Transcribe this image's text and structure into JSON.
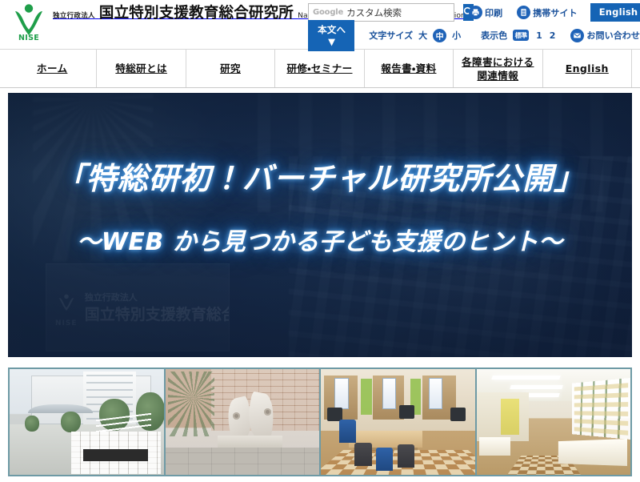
{
  "header": {
    "logo": {
      "mark_name": "nise-logo-mark",
      "acronym": "NISE",
      "sub_line": "独立行政法人",
      "main_line": "国立特別支援教育総合研究所",
      "english_line": "National Institute of Special Needs Education",
      "mark_color": "#1f9e4a"
    },
    "search": {
      "engine_label": "Google",
      "placeholder": "カスタム検索",
      "value": "",
      "button_icon": "search-icon",
      "button_color": "#1564b5"
    },
    "util_links": [
      {
        "icon": "printer-icon",
        "label": "印刷"
      },
      {
        "icon": "mobile-site-icon",
        "label": "携帯サイト"
      }
    ],
    "english_button": "English",
    "skip_button": "本文へ▼",
    "text_size": {
      "label": "文字サイズ",
      "options": [
        "大",
        "中",
        "小"
      ],
      "selected": "中"
    },
    "display_color": {
      "label": "表示色",
      "options": [
        "標準",
        "1",
        "2"
      ],
      "selected": "標準"
    },
    "contact": {
      "icon": "mail-icon",
      "label": "お問い合わせ"
    },
    "accent_color": "#1564b5",
    "link_color": "#19519b"
  },
  "nav": {
    "items": [
      {
        "label": "ホーム"
      },
      {
        "label": "特総研とは"
      },
      {
        "label": "研究"
      },
      {
        "label": "研修・セミナー"
      },
      {
        "label": "報告書・資料"
      },
      {
        "label_line1": "各障害における",
        "label_line2": "関連情報"
      },
      {
        "label": "English"
      }
    ]
  },
  "hero": {
    "title": "「特総研初！バーチャル研究所公開」",
    "subtitle": "〜WEB から見つかる子ども支援のヒント〜",
    "sign_overlay": {
      "acronym": "NISE",
      "line1": "独立行政法人",
      "line2": "国立特別支援教育総合研究所"
    },
    "background_color": "#1b3558",
    "glow_color": "#2f7fd0"
  },
  "thumbnails": {
    "border_color": "#6e9aa5",
    "items": [
      {
        "name": "campus-entrance-photo",
        "alt": "研究所正門と建物"
      },
      {
        "name": "stone-monument-photo",
        "alt": "石のモニュメント"
      },
      {
        "name": "resource-room-photo",
        "alt": "教材・支援機器展示室"
      },
      {
        "name": "display-corridor-photo",
        "alt": "掲示板のある廊下"
      }
    ]
  }
}
